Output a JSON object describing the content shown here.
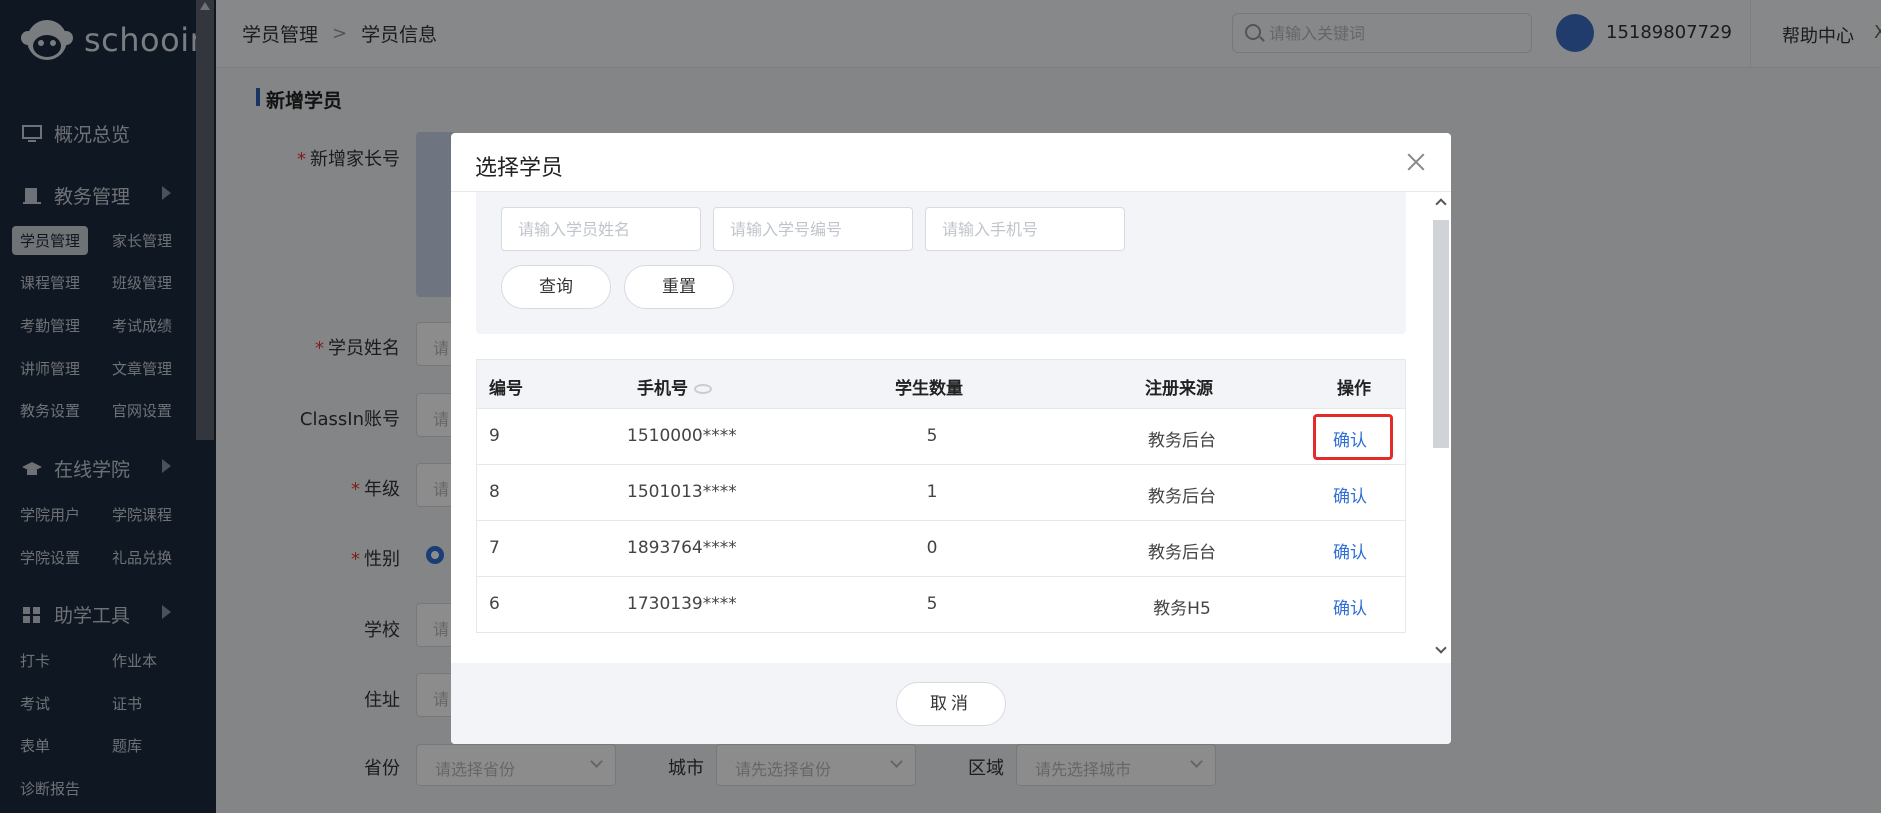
{
  "app": {
    "logo_text": "schooin"
  },
  "sidebar": {
    "groups": [
      {
        "label": "概况总览",
        "icon": "monitor-icon"
      },
      {
        "label": "教务管理",
        "icon": "building-icon"
      },
      {
        "label": "在线学院",
        "icon": "graduation-cap-icon"
      },
      {
        "label": "助学工具",
        "icon": "apps-grid-icon"
      }
    ],
    "items": [
      "学员管理",
      "家长管理",
      "课程管理",
      "班级管理",
      "考勤管理",
      "考试成绩",
      "讲师管理",
      "文章管理",
      "教务设置",
      "官网设置",
      "学院用户",
      "学院课程",
      "学院设置",
      "礼品兑换",
      "打卡",
      "作业本",
      "考试",
      "证书",
      "表单",
      "题库",
      "诊断报告"
    ]
  },
  "header": {
    "breadcrumb": [
      "学员管理",
      "学员信息"
    ],
    "search_placeholder": "请输入关键词",
    "phone": "15189807729",
    "help": "帮助中心",
    "close_glyph": "X"
  },
  "form": {
    "title": "新增学员",
    "labels": {
      "parent_no": "新增家长号",
      "student_name": "学员姓名",
      "classin": "ClassIn账号",
      "grade": "年级",
      "gender": "性别",
      "school": "学校",
      "address": "住址",
      "province": "省份",
      "city": "城市",
      "district": "区域"
    },
    "input_placeholder_fragment": "请",
    "province_placeholder": "请选择省份",
    "city_placeholder": "请先选择省份",
    "district_placeholder": "请先选择城市"
  },
  "modal": {
    "title": "选择学员",
    "filters": {
      "name_placeholder": "请输入学员姓名",
      "id_placeholder": "请输入学号编号",
      "phone_placeholder": "请输入手机号"
    },
    "query_label": "查询",
    "reset_label": "重置",
    "columns": [
      "编号",
      "手机号",
      "学生数量",
      "注册来源",
      "操作"
    ],
    "rows": [
      {
        "id": "9",
        "phone": "1510000****",
        "count": "5",
        "source": "教务后台",
        "action": "确认"
      },
      {
        "id": "8",
        "phone": "1501013****",
        "count": "1",
        "source": "教务后台",
        "action": "确认"
      },
      {
        "id": "7",
        "phone": "1893764****",
        "count": "0",
        "source": "教务后台",
        "action": "确认"
      },
      {
        "id": "6",
        "phone": "1730139****",
        "count": "5",
        "source": "教务H5",
        "action": "确认"
      }
    ],
    "cancel_label": "取消"
  },
  "colors": {
    "sidebar_bg": "#1d2a3f",
    "accent": "#2f6fd6",
    "highlight": "#e32b2b"
  }
}
